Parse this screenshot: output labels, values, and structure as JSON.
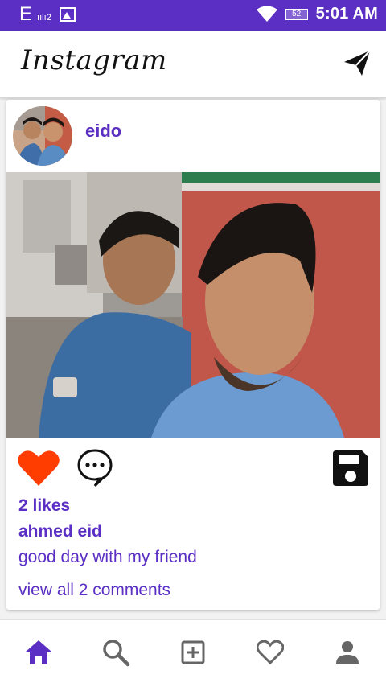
{
  "status_bar": {
    "carrier": "E",
    "signal_label": "ıılı2",
    "battery": "52",
    "time": "5:01 AM"
  },
  "app_bar": {
    "title": "Instagram",
    "send_icon": "send-icon"
  },
  "post": {
    "username": "eido",
    "likes": "2 likes",
    "author": "ahmed eid",
    "caption": "good day with my friend",
    "view_comments": "view all 2 comments",
    "icons": {
      "like": "heart-icon",
      "comment": "comment-icon",
      "save": "floppy-disk-icon"
    },
    "like_color": "#ff3d00",
    "accent_color": "#5b2fc4"
  },
  "bottom_nav": {
    "items": [
      {
        "name": "home",
        "icon": "home-icon",
        "active": true
      },
      {
        "name": "search",
        "icon": "search-icon",
        "active": false
      },
      {
        "name": "add",
        "icon": "add-box-icon",
        "active": false
      },
      {
        "name": "activity",
        "icon": "heart-outline-icon",
        "active": false
      },
      {
        "name": "profile",
        "icon": "person-icon",
        "active": false
      }
    ]
  }
}
